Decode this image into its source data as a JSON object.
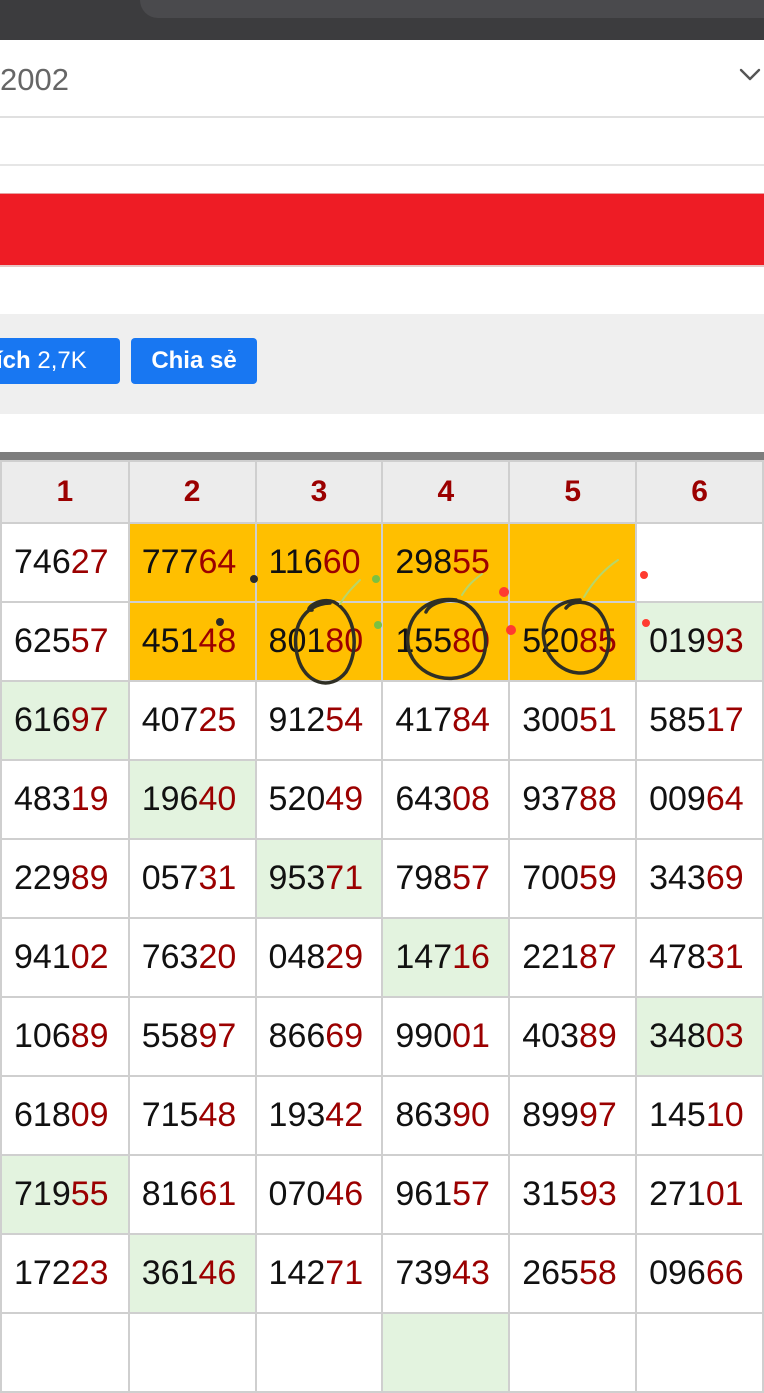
{
  "select": {
    "value": "2002"
  },
  "social": {
    "like_label": "ích",
    "like_count": "2,7K",
    "share_label": "Chia sẻ"
  },
  "grid": {
    "headers": [
      "1",
      "2",
      "3",
      "4",
      "5",
      "6"
    ],
    "rows": [
      [
        {
          "head": "746",
          "tail": "27"
        },
        {
          "head": "777",
          "tail": "64",
          "hl": true
        },
        {
          "head": "116",
          "tail": "60",
          "hl": true
        },
        {
          "head": "298",
          "tail": "55",
          "hl": true
        },
        {
          "head": "",
          "tail": "",
          "hl": true
        },
        {
          "head": "",
          "tail": ""
        }
      ],
      [
        {
          "head": "625",
          "tail": "57"
        },
        {
          "head": "451",
          "tail": "48",
          "hl": true
        },
        {
          "head": "801",
          "tail": "80",
          "hl": true
        },
        {
          "head": "155",
          "tail": "80",
          "hl": true
        },
        {
          "head": "520",
          "tail": "85",
          "hl": true
        },
        {
          "head": "019",
          "tail": "93",
          "gr": true
        }
      ],
      [
        {
          "head": "616",
          "tail": "97",
          "gr": true
        },
        {
          "head": "407",
          "tail": "25"
        },
        {
          "head": "912",
          "tail": "54"
        },
        {
          "head": "417",
          "tail": "84"
        },
        {
          "head": "300",
          "tail": "51"
        },
        {
          "head": "585",
          "tail": "17"
        }
      ],
      [
        {
          "head": "483",
          "tail": "19"
        },
        {
          "head": "196",
          "tail": "40",
          "gr": true
        },
        {
          "head": "520",
          "tail": "49"
        },
        {
          "head": "643",
          "tail": "08"
        },
        {
          "head": "937",
          "tail": "88"
        },
        {
          "head": "009",
          "tail": "64"
        }
      ],
      [
        {
          "head": "229",
          "tail": "89"
        },
        {
          "head": "057",
          "tail": "31"
        },
        {
          "head": "953",
          "tail": "71",
          "gr": true
        },
        {
          "head": "798",
          "tail": "57"
        },
        {
          "head": "700",
          "tail": "59"
        },
        {
          "head": "343",
          "tail": "69"
        }
      ],
      [
        {
          "head": "941",
          "tail": "02"
        },
        {
          "head": "763",
          "tail": "20"
        },
        {
          "head": "048",
          "tail": "29"
        },
        {
          "head": "147",
          "tail": "16",
          "gr": true
        },
        {
          "head": "221",
          "tail": "87"
        },
        {
          "head": "478",
          "tail": "31"
        }
      ],
      [
        {
          "head": "106",
          "tail": "89"
        },
        {
          "head": "558",
          "tail": "97"
        },
        {
          "head": "866",
          "tail": "69"
        },
        {
          "head": "990",
          "tail": "01"
        },
        {
          "head": "403",
          "tail": "89"
        },
        {
          "head": "348",
          "tail": "03",
          "gr": true
        }
      ],
      [
        {
          "head": "618",
          "tail": "09"
        },
        {
          "head": "715",
          "tail": "48"
        },
        {
          "head": "193",
          "tail": "42"
        },
        {
          "head": "863",
          "tail": "90"
        },
        {
          "head": "899",
          "tail": "97"
        },
        {
          "head": "145",
          "tail": "10"
        }
      ],
      [
        {
          "head": "719",
          "tail": "55",
          "gr": true
        },
        {
          "head": "816",
          "tail": "61"
        },
        {
          "head": "070",
          "tail": "46"
        },
        {
          "head": "961",
          "tail": "57"
        },
        {
          "head": "315",
          "tail": "93"
        },
        {
          "head": "271",
          "tail": "01"
        }
      ],
      [
        {
          "head": "172",
          "tail": "23"
        },
        {
          "head": "361",
          "tail": "46",
          "gr": true
        },
        {
          "head": "142",
          "tail": "71"
        },
        {
          "head": "739",
          "tail": "43"
        },
        {
          "head": "265",
          "tail": "58"
        },
        {
          "head": "096",
          "tail": "66"
        }
      ],
      [
        {
          "head": "",
          "tail": ""
        },
        {
          "head": "",
          "tail": ""
        },
        {
          "head": "",
          "tail": ""
        },
        {
          "head": "",
          "tail": "",
          "gr": true
        },
        {
          "head": "",
          "tail": ""
        },
        {
          "head": "",
          "tail": ""
        }
      ]
    ]
  },
  "colors": {
    "highlight": "#ffbf00",
    "green": "#e3f3df",
    "accent_red": "#ee1c25",
    "tail_digits": "#9b0000",
    "facebook_blue": "#1877f2"
  }
}
